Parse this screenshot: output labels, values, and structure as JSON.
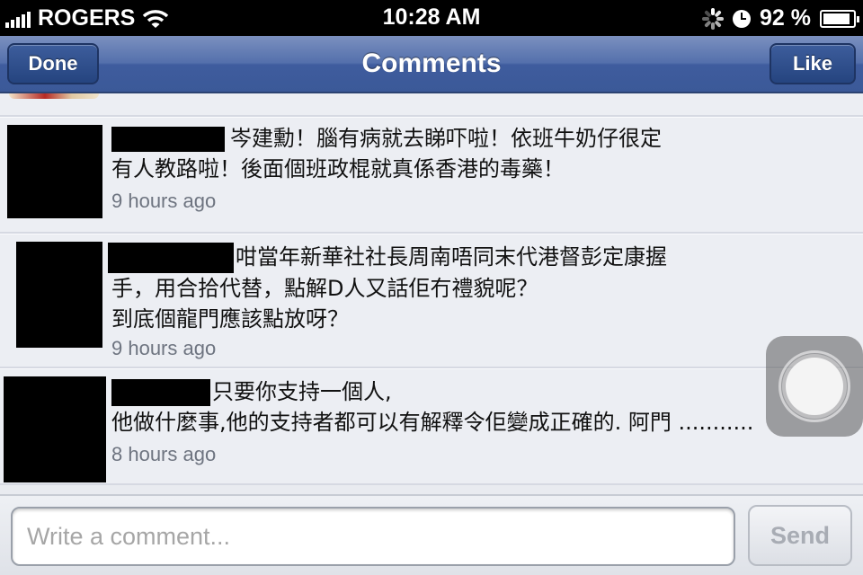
{
  "status_bar": {
    "carrier": "ROGERS",
    "time": "10:28 AM",
    "battery": "92 %",
    "battery_level": 0.92,
    "icons": [
      "signal-bars-icon",
      "wifi-icon",
      "activity-spinner-icon",
      "alarm-clock-icon",
      "battery-icon"
    ]
  },
  "nav": {
    "title": "Comments",
    "left_button": "Done",
    "right_button": "Like"
  },
  "comments": [
    {
      "lines": [
        "岑建勳！腦有病就去睇吓啦！依班牛奶仔很定",
        "有人教路啦！後面個班政棍就真係香港的毒藥！"
      ],
      "time": "9 hours ago"
    },
    {
      "lines": [
        "咁當年新華社社長周南唔同末代港督彭定康握",
        "手，用合拾代替，點解D人又話佢冇禮貌呢？",
        "到底個龍門應該點放呀？"
      ],
      "time": "9 hours ago"
    },
    {
      "lines": [
        "只要你支持一個人,",
        "他做什麼事,他的支持者都可以有解釋令佢變成正確的. 阿門 ..........."
      ],
      "time": "8 hours ago"
    }
  ],
  "composer": {
    "placeholder": "Write a comment...",
    "send_label": "Send"
  },
  "colors": {
    "nav_blue": "#3b5998",
    "content_bg": "#e9ebf0",
    "timestamp_gray": "#6e7480"
  }
}
